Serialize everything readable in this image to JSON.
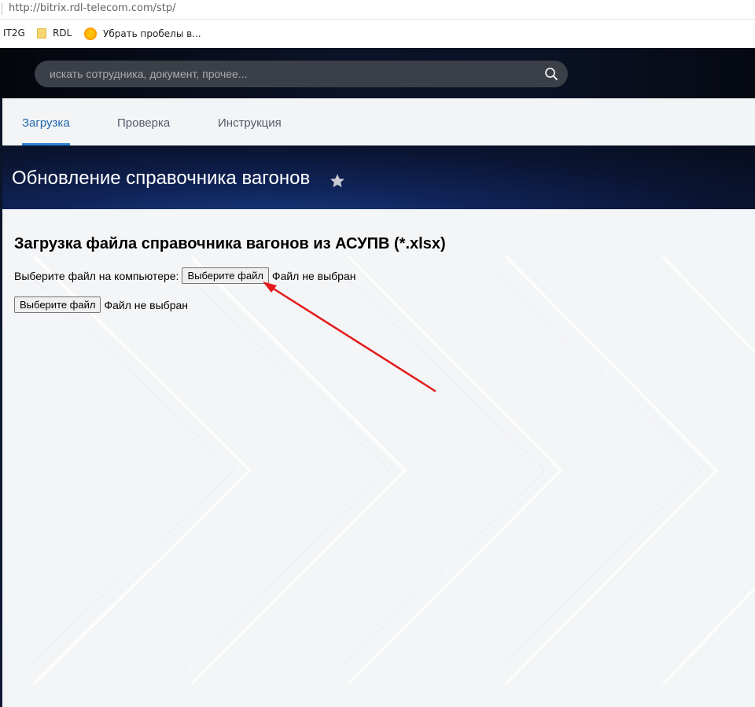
{
  "browser": {
    "url": "http://bitrix.rdl-telecom.com/stp/",
    "bookmarks": [
      {
        "label": "IT2G",
        "icon": "none"
      },
      {
        "label": "RDL",
        "icon": "folder-icon"
      },
      {
        "label": "Убрать пробелы в...",
        "icon": "circle-icon"
      }
    ]
  },
  "header": {
    "search_placeholder": "искать сотрудника, документ, прочее..."
  },
  "tabs": [
    {
      "label": "Загрузка",
      "active": true
    },
    {
      "label": "Проверка",
      "active": false
    },
    {
      "label": "Инструкция",
      "active": false
    }
  ],
  "page": {
    "title": "Обновление справочника вагонов"
  },
  "content": {
    "heading": "Загрузка файла справочника вагонов из АСУПВ (*.xlsx)",
    "row1_label": "Выберите файл на компьютере:",
    "row1_button": "Выберите файл",
    "row1_status": "Файл не выбран",
    "row2_button": "Выберите файл",
    "row2_status": "Файл не выбран"
  },
  "colors": {
    "accent": "#2067b0",
    "annotation_arrow": "#e31b1b"
  }
}
